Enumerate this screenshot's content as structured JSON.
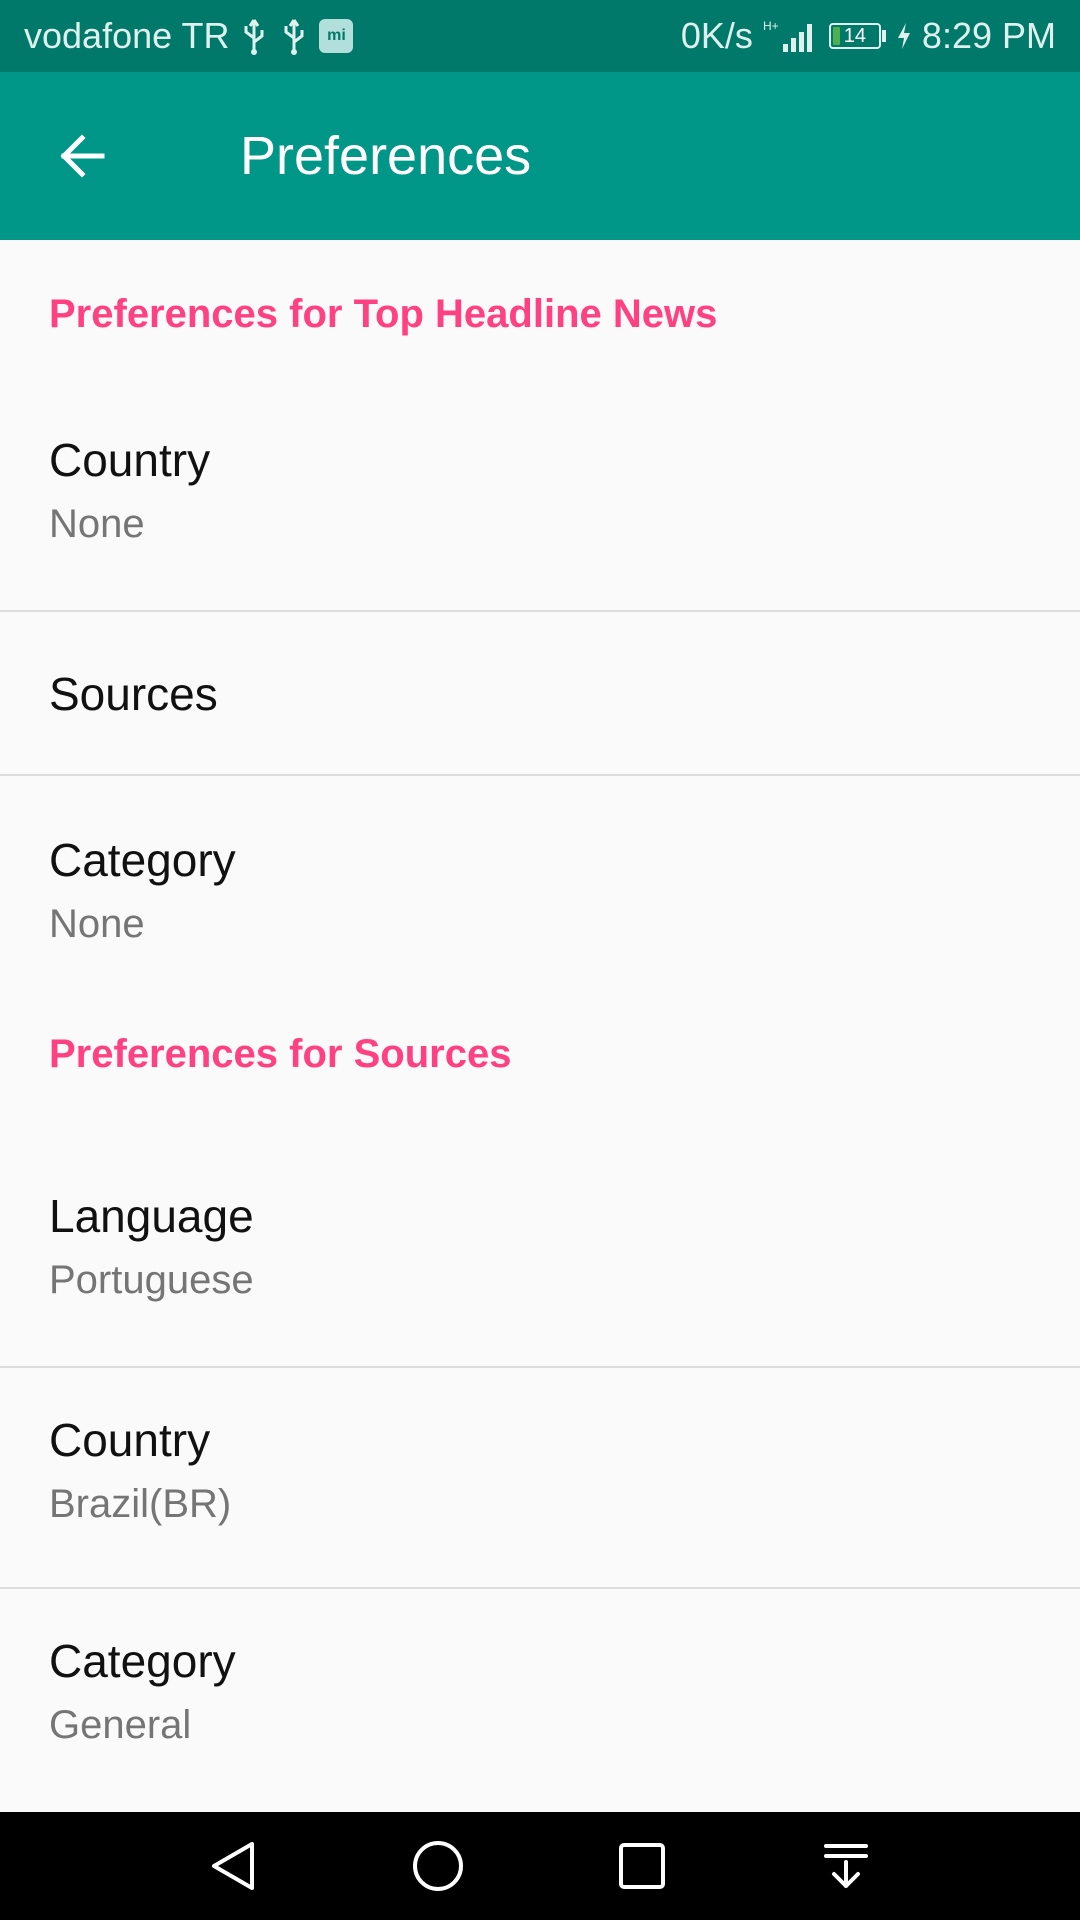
{
  "status_bar": {
    "carrier": "vodafone TR",
    "net_speed": "0K/s",
    "network_type": "H+",
    "battery_level": "14",
    "time": "8:29 PM",
    "icons": [
      "usb-icon",
      "usb-icon",
      "mi-app-icon",
      "signal-icon",
      "battery-icon",
      "charging-icon"
    ]
  },
  "app_bar": {
    "title": "Preferences",
    "back_icon": "arrow-left-icon",
    "background_color": "#009688"
  },
  "sections": [
    {
      "header": "Preferences for Top Headline News",
      "items": [
        {
          "title": "Country",
          "summary": "None"
        },
        {
          "title": "Sources",
          "summary": ""
        },
        {
          "title": "Category",
          "summary": "None"
        }
      ]
    },
    {
      "header": "Preferences for Sources",
      "items": [
        {
          "title": "Language",
          "summary": "Portuguese"
        },
        {
          "title": "Country",
          "summary": "Brazil(BR)"
        },
        {
          "title": "Category",
          "summary": "General"
        }
      ]
    }
  ],
  "nav_bar": {
    "buttons": [
      "back-triangle-icon",
      "home-circle-icon",
      "recents-square-icon",
      "notification-pull-down-icon"
    ]
  },
  "colors": {
    "accent": "#ff4081",
    "primary": "#009688",
    "primary_dark": "#00796b"
  }
}
